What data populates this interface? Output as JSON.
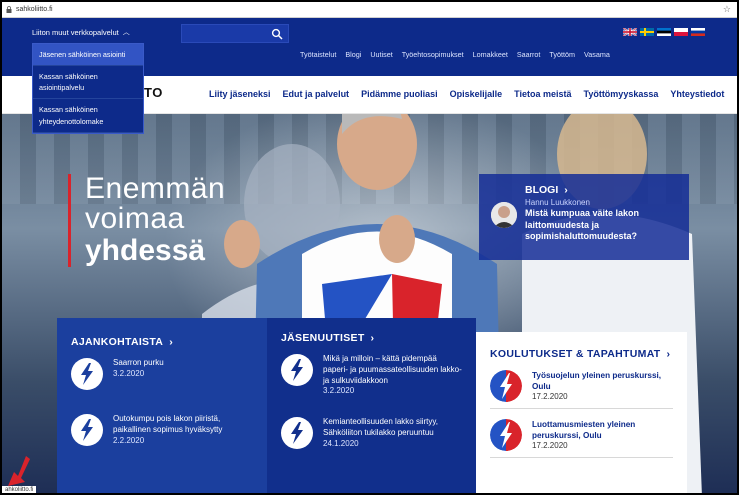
{
  "browser": {
    "url": "sahkoliitto.fi"
  },
  "topbar": {
    "services_label": "Liiton muut verkkopalvelut",
    "search_placeholder": "",
    "util_links": [
      "Työtaistelut",
      "Blogi",
      "Uutiset",
      "Työehtosopimukset",
      "Lomakkeet",
      "Saarrot",
      "Työttöm",
      "Vasama"
    ]
  },
  "dropdown": {
    "items": [
      "Jäsenen sähköinen asiointi",
      "Kassan sähköinen asiointipalvelu",
      "Kassan sähköinen yhteydenottolomake"
    ]
  },
  "mainnav": {
    "logo_tail": "TO",
    "items": [
      "Liity jäseneksi",
      "Edut ja palvelut",
      "Pidämme puoliasi",
      "Opiskelijalle",
      "Tietoa meistä",
      "Työttömyyskassa",
      "Yhteystiedot"
    ]
  },
  "hero": {
    "slogan_line1": "Enemmän",
    "slogan_line2": "voimaa",
    "slogan_line3": "yhdessä"
  },
  "blog": {
    "title": "BLOGI",
    "chevron": "›",
    "author": "Hannu Luukkonen",
    "text": "Mistä kumpuaa väite lakon laittomuudesta ja sopimishaluttomuudesta?"
  },
  "ajankohtaista": {
    "title": "AJANKOHTAISTA",
    "items": [
      {
        "text": "Saarron purku",
        "date": "3.2.2020"
      },
      {
        "text": "Outokumpu pois lakon piiristä, paikallinen sopimus hyväksytty",
        "date": "2.2.2020"
      }
    ]
  },
  "jasenuutiset": {
    "title": "JÄSENUUTISET",
    "items": [
      {
        "text": "Mikä ja milloin – kättä pidempää paperi- ja puumassateollisuuden lakko- ja sulkuviidakkoon",
        "date": "3.2.2020"
      },
      {
        "text": "Kemianteollisuuden lakko siirtyy, Sähköliiton tukilakko peruuntuu",
        "date": "24.1.2020"
      }
    ]
  },
  "koulutukset": {
    "title": "KOULUTUKSET & TAPAHTUMAT",
    "items": [
      {
        "text": "Työsuojelun yleinen peruskurssi, Oulu",
        "date": "17.2.2020"
      },
      {
        "text": "Luottamusmiesten yleinen peruskurssi, Oulu",
        "date": "17.2.2020"
      }
    ]
  },
  "statusbar": {
    "text": "ahkoliitto.fi"
  },
  "colors": {
    "brand_blue": "#0d2a8a",
    "accent_red": "#d9232b"
  }
}
